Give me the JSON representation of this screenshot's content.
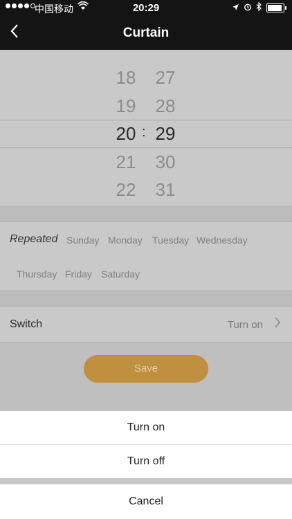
{
  "status_bar": {
    "carrier": "中国移动",
    "time": "20:29"
  },
  "nav": {
    "title": "Curtain"
  },
  "picker": {
    "hours": [
      "18",
      "19",
      "20",
      "21",
      "22"
    ],
    "minutes": [
      "27",
      "28",
      "29",
      "30",
      "31"
    ],
    "selected_hour": "20",
    "selected_minute": "29",
    "separator": ":"
  },
  "repeat": {
    "label": "Repeated",
    "days": [
      "Sunday",
      "Monday",
      "Tuesday",
      "Wednesday",
      "Thursday",
      "Friday",
      "Saturday"
    ]
  },
  "switch": {
    "label": "Switch",
    "value": "Turn on"
  },
  "save_label": "Save",
  "action_sheet": {
    "options": [
      "Turn on",
      "Turn off"
    ],
    "cancel": "Cancel"
  },
  "colors": {
    "nav_bg": "#141414",
    "accent": "#c08f3f",
    "overlay": "#bfbfbf"
  }
}
